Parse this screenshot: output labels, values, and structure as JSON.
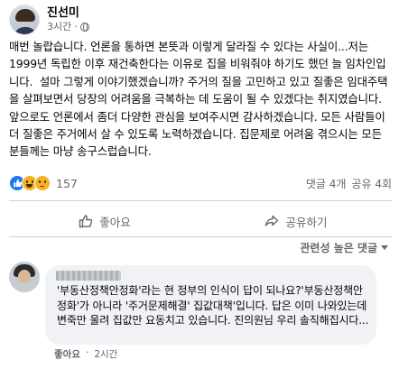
{
  "post": {
    "author": "진선미",
    "time": "3시간",
    "body": "매번 놀랍습니다. 언론을 통하면 본뜻과 이렇게 달라질 수 있다는 사실이...저는 1999년 독립한 이후 재건축한다는 이유로 집을 비워줘야 하기도 했던 늘 임차인입니다.  설마 그렇게 이야기했겠습니까? 주거의 질을 고민하고 있고 질좋은 임대주택을 살펴보면서 당장의 어려움을 극복하는 데 도움이 될 수 있겠다는 취지였습니다. 앞으로도 언론에서 좀더 다양한 관심을 보여주시면 감사하겠습니다. 모든 사람들이 더 질좋은 주거에서 살 수 있도록 노력하겠습니다. 집문제로 어려움 겪으시는 모든 분들께는 마냥 송구스럽습니다."
  },
  "reactions": {
    "count": "157",
    "types": [
      "like-icon",
      "haha-icon",
      "sad-icon"
    ]
  },
  "engagement": {
    "comments": "댓글 4개",
    "shares": "공유 4회"
  },
  "actions": {
    "like_label": "좋아요",
    "share_label": "공유하기"
  },
  "comments_sort": {
    "label": "관련성 높은 댓글"
  },
  "comment": {
    "text": "'부동산정책안정화'라는 현 정부의 인식이 답이 되나요?'부동산정책안정화'가 아니라 '주거문제해결' 집값대책'입니다. 답은 이미 나와있는데 변죽만 울려 집값만 요동치고 있습니다. 진의원님 우리 솔직해집시다...",
    "like_label": "좋아요",
    "separator": "·",
    "time": "2시간"
  },
  "colors": {
    "brand_blue": "#1877f2",
    "secondary_text": "#65676b",
    "bubble_bg": "#f0f2f5",
    "divider": "#ced0d4"
  }
}
